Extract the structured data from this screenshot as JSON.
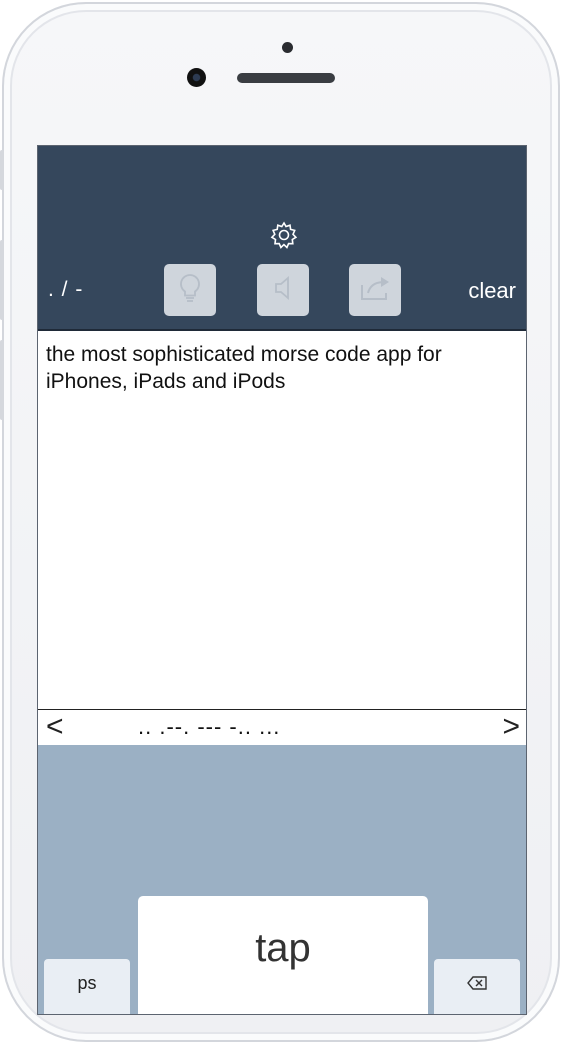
{
  "toolbar": {
    "settings_icon": "gear-icon",
    "morse_toggle_label": ". / -",
    "buttons": [
      {
        "icon": "lightbulb-icon"
      },
      {
        "icon": "speaker-icon"
      },
      {
        "icon": "share-icon"
      }
    ],
    "clear_label": "clear"
  },
  "editor": {
    "text": "the most sophisticated morse code app for iPhones, iPads and iPods"
  },
  "morse_bar": {
    "prev_label": "<",
    "code": ".. .--. --- -.. ...",
    "next_label": ">"
  },
  "keypad": {
    "tap_label": "tap",
    "left_key_label": "ps",
    "right_key_icon": "backspace-icon"
  },
  "colors": {
    "toolbar_bg": "#35475c",
    "keypad_bg": "#9bb0c4",
    "disabled_button": "#cfd5dc"
  }
}
